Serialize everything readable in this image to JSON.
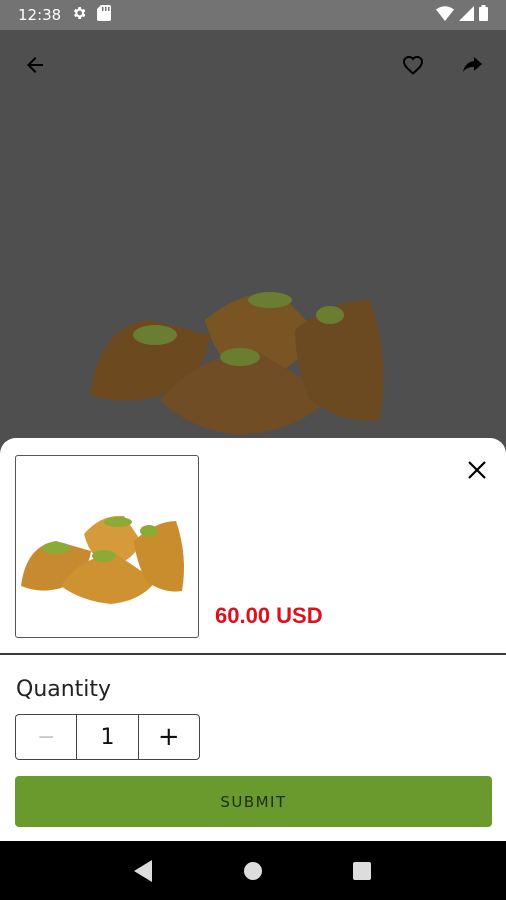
{
  "status_bar": {
    "time": "12:38"
  },
  "product": {
    "price": "60.00 USD"
  },
  "quantity": {
    "label": "Quantity",
    "value": "1",
    "minus_symbol": "−",
    "plus_symbol": "+"
  },
  "actions": {
    "submit_label": "SUBMIT"
  },
  "colors": {
    "price": "#e0101b",
    "submit_bg": "#6a9a2e",
    "status_bar": "#737373",
    "dim_bg": "#5a5a5a"
  },
  "icons": [
    "settings-icon",
    "sd-card-icon",
    "wifi-icon",
    "signal-icon",
    "battery-icon",
    "back-arrow-icon",
    "heart-icon",
    "share-icon",
    "close-icon",
    "nav-back-icon",
    "nav-home-icon",
    "nav-recents-icon"
  ]
}
